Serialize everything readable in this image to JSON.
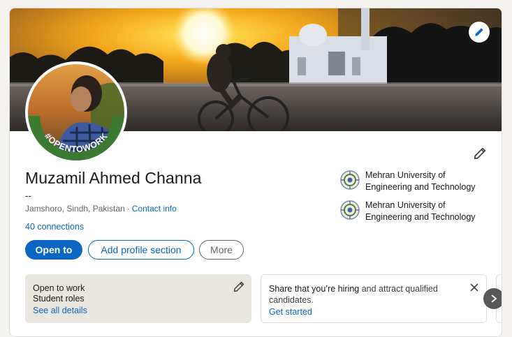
{
  "profile": {
    "name": "Muzamil Ahmed Channa",
    "headline": "--",
    "location": "Jamshoro, Sindh, Pakistan",
    "location_separator": "·",
    "contact_info_label": "Contact info",
    "connections": "40 connections",
    "open_to_work_frame_text": "#OPENTOWORK"
  },
  "actions": {
    "open_to_label": "Open to",
    "add_section_label": "Add profile section",
    "more_label": "More"
  },
  "education": [
    {
      "name_line1": "Mehran University of",
      "name_line2": "Engineering and Technology"
    },
    {
      "name_line1": "Mehran University of",
      "name_line2": "Engineering and Technology"
    }
  ],
  "open_to_work_card": {
    "title": "Open to work",
    "subtitle": "Student roles",
    "link": "See all details"
  },
  "hiring_card": {
    "text_bold": "Share that you’re hiring",
    "text_rest": " and attract qualified candidates.",
    "link": "Get started"
  },
  "icons": {
    "cover_edit": "pencil-icon",
    "intro_edit": "pencil-icon",
    "otw_edit": "pencil-icon",
    "hire_close": "close-icon",
    "carousel_next": "chevron-right-icon"
  },
  "colors": {
    "accent": "#0a66c2",
    "open_to_work_green": "#3b7a31",
    "card_bg": "#ffffff",
    "otw_card_bg": "#e9e5df"
  }
}
